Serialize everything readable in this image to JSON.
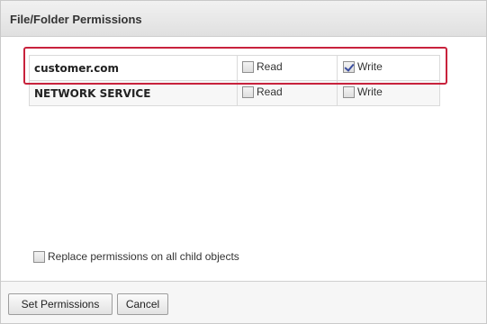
{
  "dialog": {
    "title": "File/Folder Permissions"
  },
  "permissions": {
    "rows": [
      {
        "name": "customer.com",
        "read_label": "Read",
        "read_checked": false,
        "write_label": "Write",
        "write_checked": true,
        "highlighted": true
      },
      {
        "name": "NETWORK SERVICE",
        "read_label": "Read",
        "read_checked": false,
        "write_label": "Write",
        "write_checked": false,
        "highlighted": false
      }
    ]
  },
  "options": {
    "replace_label": "Replace permissions on all child objects",
    "replace_checked": false
  },
  "footer": {
    "set_permissions_label": "Set Permissions",
    "cancel_label": "Cancel"
  },
  "colors": {
    "highlight": "#c8223c",
    "checkmark": "#3b4ea0"
  }
}
